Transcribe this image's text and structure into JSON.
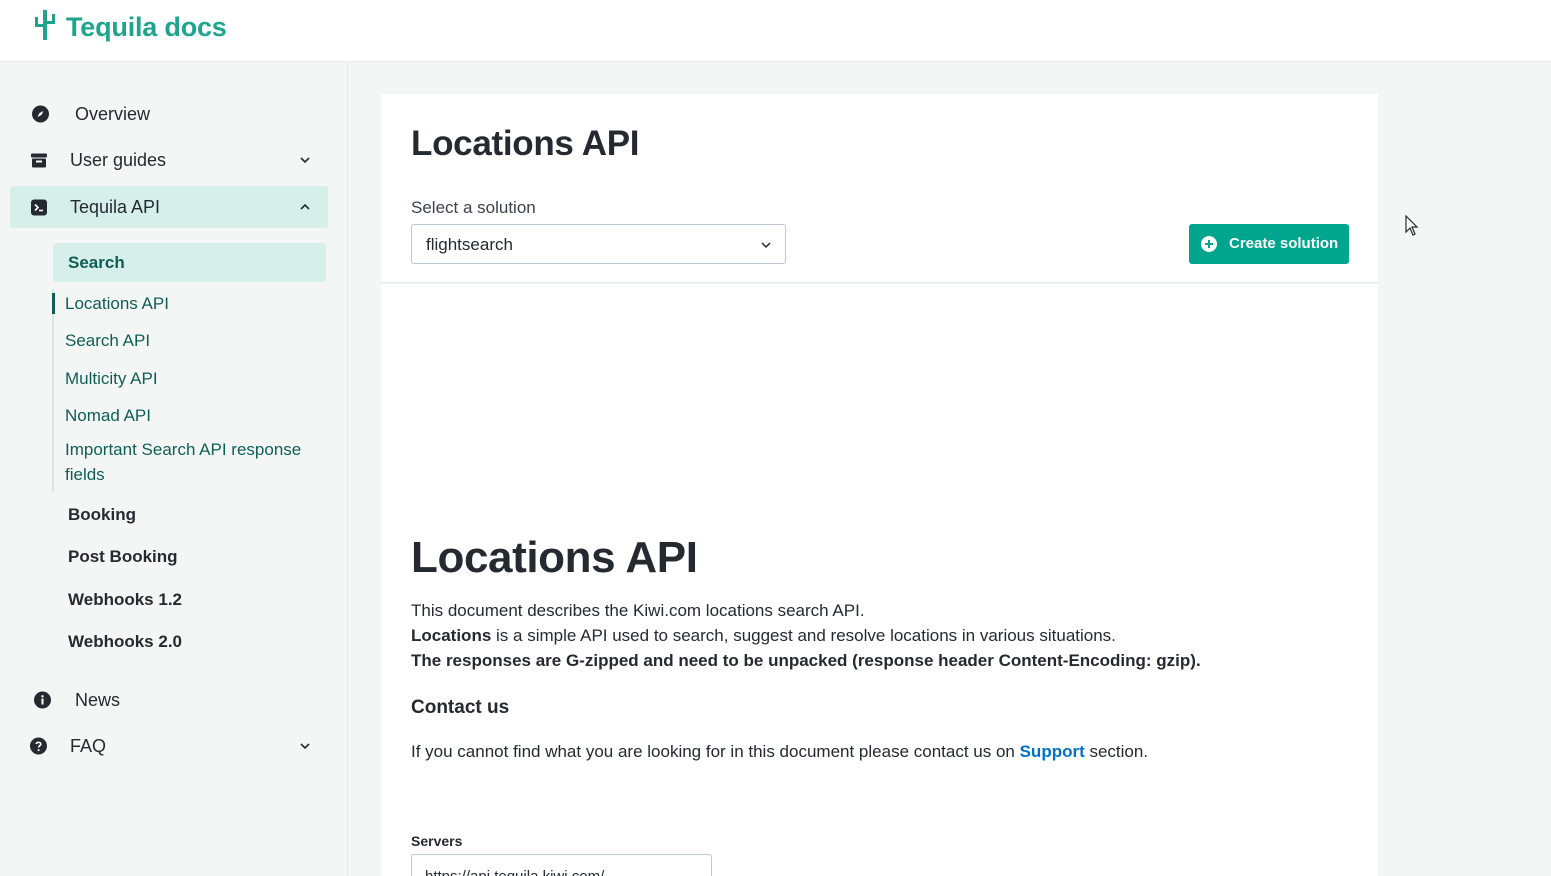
{
  "header": {
    "logo_text": "Tequila docs",
    "logo_icon": "cactus-icon",
    "accent_color": "#1fa58d"
  },
  "sidebar": {
    "items": [
      {
        "label": "Overview",
        "icon": "compass-icon"
      },
      {
        "label": "User guides",
        "icon": "archive-box-icon",
        "expandable": true,
        "expanded": false
      },
      {
        "label": "Tequila API",
        "icon": "terminal-icon",
        "expandable": true,
        "expanded": true,
        "active": true
      },
      {
        "label": "News",
        "icon": "info-icon"
      },
      {
        "label": "FAQ",
        "icon": "question-icon",
        "expandable": true,
        "expanded": false
      }
    ],
    "api_sections": [
      {
        "label": "Search",
        "active": true
      },
      {
        "label": "Booking"
      },
      {
        "label": "Post Booking"
      },
      {
        "label": "Webhooks 1.2"
      },
      {
        "label": "Webhooks 2.0"
      }
    ],
    "search_links": [
      {
        "label": "Locations API",
        "current": true
      },
      {
        "label": "Search API"
      },
      {
        "label": "Multicity API"
      },
      {
        "label": "Nomad API"
      },
      {
        "label": "Important Search API response fields"
      }
    ]
  },
  "main": {
    "page_title": "Locations API",
    "select_label": "Select a solution",
    "selected_solution": "flightsearch",
    "create_button_label": "Create solution",
    "button_color": "#00a58e",
    "doc_title": "Locations API",
    "intro_line_1": "This document describes the Kiwi.com locations search API.",
    "intro_line_2_bold": "Locations",
    "intro_line_2_rest": " is a simple API used to search, suggest and resolve locations in various situations.",
    "intro_line_3": "The responses are G-zipped and need to be unpacked (response header Content-Encoding: gzip).",
    "contact_heading": "Contact us",
    "contact_text_before": "If you cannot find what you are looking for in this document please contact us on ",
    "contact_link": "Support",
    "contact_text_after": " section.",
    "link_color": "#0172cb",
    "servers_label": "Servers",
    "servers_value": "https://api.tequila.kiwi.com/"
  }
}
